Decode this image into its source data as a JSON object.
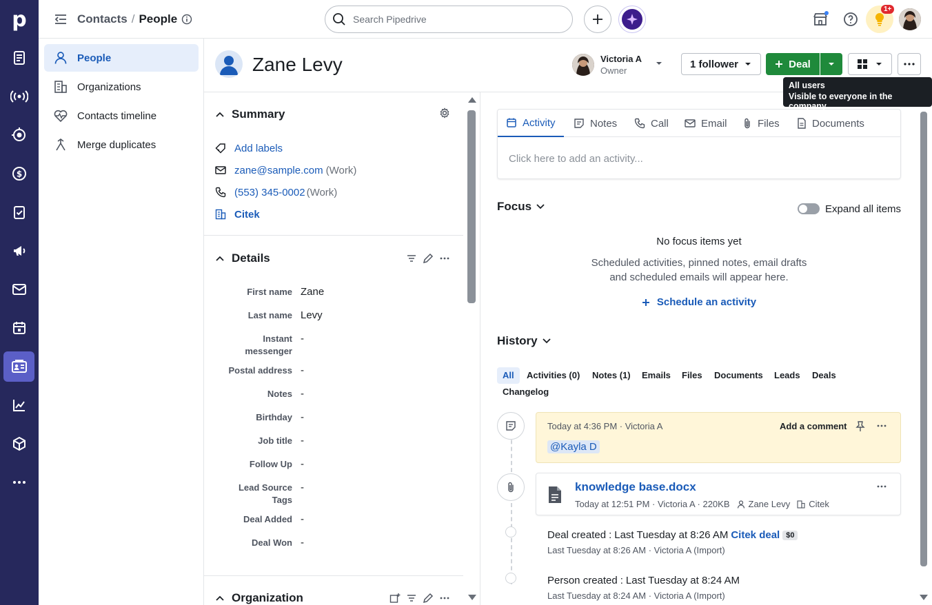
{
  "app": {
    "logo_letter": "p"
  },
  "rail": {
    "icons": [
      "leads-icon",
      "signal-icon",
      "target-icon",
      "deals-icon",
      "tasks-icon",
      "campaigns-icon",
      "mail-icon",
      "calendar-icon",
      "contacts-icon",
      "insights-icon",
      "products-icon",
      "more-icon"
    ],
    "active": "contacts-icon"
  },
  "topbar": {
    "crumb_parent": "Contacts",
    "crumb_sep": "/",
    "crumb_current": "People",
    "search_placeholder": "Search Pipedrive",
    "notification_badge": "1+"
  },
  "sidebar": {
    "items": [
      {
        "label": "People",
        "icon": "person-icon",
        "active": true
      },
      {
        "label": "Organizations",
        "icon": "building-icon",
        "active": false
      },
      {
        "label": "Contacts timeline",
        "icon": "heartbeat-icon",
        "active": false
      },
      {
        "label": "Merge duplicates",
        "icon": "merge-icon",
        "active": false
      }
    ]
  },
  "header": {
    "person_name": "Zane Levy",
    "owner_name": "Victoria A",
    "owner_role": "Owner",
    "follower_label": "1 follower",
    "deal_label": "Deal",
    "tooltip_title": "All users",
    "tooltip_text": "Visible to everyone in the company"
  },
  "summary": {
    "title": "Summary",
    "add_labels": "Add labels",
    "email": "zane@sample.com",
    "email_type": "(Work)",
    "phone": "(553) 345-0002",
    "phone_type": "(Work)",
    "organization": "Citek"
  },
  "details": {
    "title": "Details",
    "fields": [
      {
        "label": "First name",
        "value": "Zane"
      },
      {
        "label": "Last name",
        "value": "Levy"
      },
      {
        "label": "Instant messenger",
        "value": "-"
      },
      {
        "label": "Postal address",
        "value": "-"
      },
      {
        "label": "Notes",
        "value": "-"
      },
      {
        "label": "Birthday",
        "value": "-"
      },
      {
        "label": "Job title",
        "value": "-"
      },
      {
        "label": "Follow Up",
        "value": "-"
      },
      {
        "label": "Lead Source Tags",
        "value": "-"
      },
      {
        "label": "Deal Added",
        "value": "-"
      },
      {
        "label": "Deal Won",
        "value": "-"
      }
    ]
  },
  "organization_section": {
    "title": "Organization"
  },
  "activity_tabs": {
    "tabs": [
      "Activity",
      "Notes",
      "Call",
      "Email",
      "Files",
      "Documents"
    ],
    "placeholder": "Click here to add an activity..."
  },
  "focus": {
    "title": "Focus",
    "expand_label": "Expand all items",
    "empty_title": "No focus items yet",
    "empty_line1": "Scheduled activities, pinned notes, email drafts",
    "empty_line2": "and scheduled emails will appear here.",
    "schedule_label": "Schedule an activity"
  },
  "history": {
    "title": "History",
    "filters": [
      "All",
      "Activities (0)",
      "Notes (1)",
      "Emails",
      "Files",
      "Documents",
      "Leads",
      "Deals",
      "Changelog"
    ],
    "note": {
      "meta": "Today at 4:36 PM · Victoria A",
      "add_comment": "Add a comment",
      "mention": "@Kayla D"
    },
    "file": {
      "name": "knowledge base.docx",
      "meta": "Today at 12:51 PM · Victoria A · 220KB",
      "person": "Zane Levy",
      "org": "Citek"
    },
    "deal_event": {
      "prefix": "Deal created",
      "text": "Last Tuesday at 8:26 AM",
      "link": "Citek deal",
      "badge": "$0",
      "meta": "Last Tuesday at 8:26 AM · Victoria A (Import)"
    },
    "person_event": {
      "prefix": "Person created",
      "text": "Last Tuesday at 8:24 AM",
      "meta": "Last Tuesday at 8:24 AM · Victoria A (Import)"
    }
  },
  "colors": {
    "rail": "#26285c",
    "accent": "#1a5bb8",
    "green": "#1f8a3b",
    "note_bg": "#fff6d9"
  }
}
